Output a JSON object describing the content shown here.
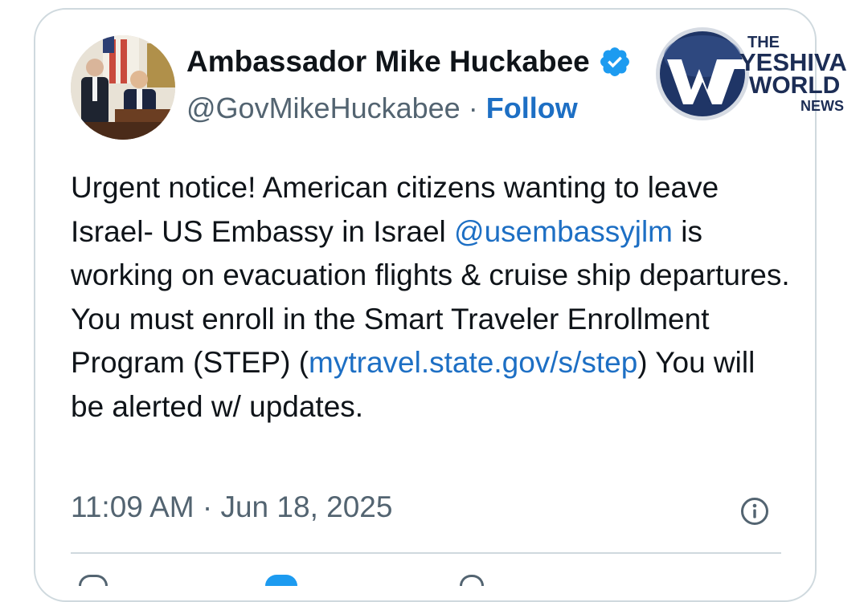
{
  "author": {
    "display_name": "Ambassador Mike Huckabee",
    "handle": "@GovMikeHuckabee",
    "separator": "·",
    "follow_label": "Follow",
    "verified": true,
    "verified_color": "#1d9bf0"
  },
  "watermark": {
    "line1": "THE",
    "line2": "YESHIVA",
    "line3": "WORLD",
    "line4": "NEWS"
  },
  "tweet": {
    "p1_text": "Urgent notice! American citizens wanting to leave Israel-  US Embassy in Israel ",
    "p1_mention": "@usembassyjlm",
    "p1_tail": " is working on evacuation flights & cruise ship departures.",
    "p2_text": "You must enroll in the Smart Traveler Enrollment Program (STEP) (",
    "p2_link": "mytravel.state.gov/s/step",
    "p2_tail": ") You will be alerted w/ updates."
  },
  "meta": {
    "time": "11:09 AM",
    "separator": "·",
    "date": "Jun 18, 2025"
  },
  "colors": {
    "link": "#1d6fc4",
    "secondary_text": "#536471",
    "border": "#cfd9de"
  }
}
